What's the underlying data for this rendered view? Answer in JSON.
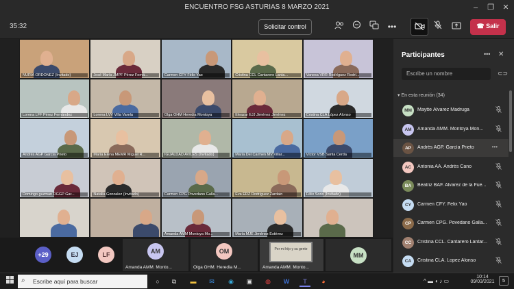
{
  "window": {
    "title": "ENCUENTRO FSG ASTURIAS 8 MARZO 2021"
  },
  "meeting": {
    "timer": "35:32",
    "request_control": "Solicitar control",
    "leave": "Salir",
    "icons": [
      "participants-icon",
      "chat-icon",
      "reactions-icon",
      "more-icon",
      "camera-off-icon",
      "mic-off-icon",
      "share-icon",
      "phone-icon"
    ]
  },
  "grid": [
    "NURIA ORDOÑEZ (Invitado)",
    "José María JMPF Pérez Ferná...",
    "Carmen CFY Félix Yao",
    "Cristina CCL Cantarero Lanta...",
    "Vanesa VRR Rodríguez Rodrí...",
    "Lorena LFF Pérez Fernández",
    "Lorena LVV Villa Varela",
    "Olga OHM Heredia Montoya",
    "Eleazar EJJ Jiménez Jiménez",
    "Cristina CLA López Alonso",
    "Andrés AGP García Prieto",
    "María Elena MEMR Miguel R...",
    "IGUALDAD AVILES (Invitado)",
    "María Del Carmen MV Villar...",
    "Víctor VSB Santa Cerda",
    "Domingo guzman DGGP Gar...",
    "Natalia Gonzalez (Invitado)",
    "Carmen CPG Povedano Galla...",
    "Eva ERZ Rodríguez Zardain",
    "Félix Sorio (Invitado)",
    "",
    "",
    "Amanda AMM Montoya Mo...",
    "María MJE Jiménez Estévez",
    ""
  ],
  "strip": {
    "overflow": "+29",
    "avatars": [
      "EJ",
      "LF"
    ],
    "tiles": [
      {
        "initials": "AM",
        "label": "Amanda AMM. Monto..."
      },
      {
        "initials": "OM",
        "label": "Olga OHM. Heredia M..."
      },
      {
        "initials": "",
        "label": "Amanda AMM. Monto...",
        "quote": "Por mi hijo y su gente"
      },
      {
        "initials": "MM",
        "label": ""
      }
    ]
  },
  "panel": {
    "title": "Participantes",
    "search_placeholder": "Escribe un nombre",
    "section": "En esta reunión (34)",
    "participants": [
      {
        "initials": "MM",
        "name": "Maytte Álvarez Madruga",
        "color": "#c7e0c4"
      },
      {
        "initials": "AM",
        "name": "Amanda AMM. Montoya Mon...",
        "color": "#c8c6f0"
      },
      {
        "initials": "AP",
        "name": "Andrés AGP. García Prieto",
        "color": "#6a5343",
        "selected": true
      },
      {
        "initials": "AC",
        "name": "Antonia AA. Andrés Cano",
        "color": "#f3c7c0"
      },
      {
        "initials": "BA",
        "name": "Beatriz BAF. Alvarez de la Fue...",
        "color": "#7a8a5a"
      },
      {
        "initials": "CY",
        "name": "Carmen CFY. Felix Yao",
        "color": "#c5dcf2"
      },
      {
        "initials": "CP",
        "name": "Carmen CPG. Povedano Galla...",
        "color": "#8a6a4a"
      },
      {
        "initials": "CC",
        "name": "Cristina CCL. Cantarero Lantar...",
        "color": "#a08070"
      },
      {
        "initials": "CA",
        "name": "Cristina CLA. Lopez Alonso",
        "color": "#c5dcf2"
      }
    ]
  },
  "taskbar": {
    "search": "Escribe aquí para buscar",
    "time": "10:14",
    "date": "09/03/2021",
    "notif": "5"
  }
}
